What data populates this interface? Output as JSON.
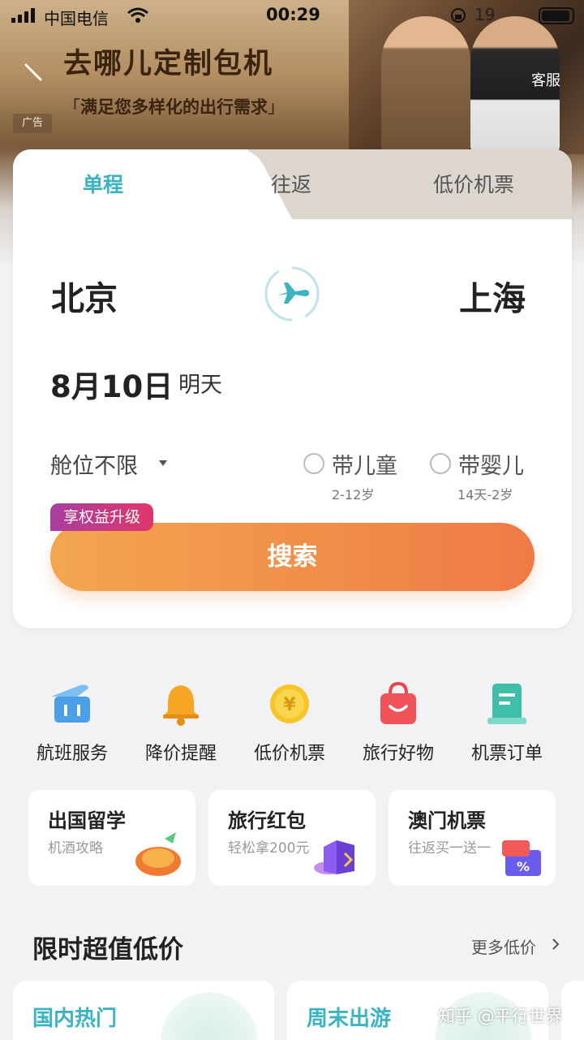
{
  "status_bar": {
    "carrier": "中国电信",
    "time": "00:29",
    "battery_text": "19"
  },
  "banner": {
    "title": "去哪儿定制包机",
    "subtitle": "满足您多样化的出行需求",
    "ad_label": "广告",
    "service_label": "客服"
  },
  "tabs": [
    {
      "label": "单程",
      "active": true
    },
    {
      "label": "往返",
      "active": false
    },
    {
      "label": "低价机票",
      "active": false
    }
  ],
  "search": {
    "from_city": "北京",
    "to_city": "上海",
    "date": "8月10日",
    "date_relative": "明天",
    "cabin": "舱位不限",
    "child_option": {
      "label": "带儿童",
      "sub": "2-12岁"
    },
    "infant_option": {
      "label": "带婴儿",
      "sub": "14天-2岁"
    },
    "perk_badge": "享权益升级",
    "button_label": "搜索"
  },
  "quick_actions": [
    {
      "label": "航班服务",
      "icon": "flight-service-icon"
    },
    {
      "label": "降价提醒",
      "icon": "bell-icon"
    },
    {
      "label": "低价机票",
      "icon": "yuan-coin-icon"
    },
    {
      "label": "旅行好物",
      "icon": "shopping-bag-icon"
    },
    {
      "label": "机票订单",
      "icon": "order-list-icon"
    }
  ],
  "promos": [
    {
      "title": "出国留学",
      "sub": "机酒攻略"
    },
    {
      "title": "旅行红包",
      "sub": "轻松拿200元"
    },
    {
      "title": "澳门机票",
      "sub": "往返买一送一"
    }
  ],
  "section": {
    "title": "限时超值低价",
    "more": "更多低价"
  },
  "deals": [
    {
      "title": "国内热门"
    },
    {
      "title": "周末出游"
    }
  ],
  "watermark": "知乎 @平行世界",
  "colors": {
    "accent_teal": "#3bb3c3",
    "search_orange": "#ef7a45",
    "perk_magenta": "#c0377f"
  }
}
